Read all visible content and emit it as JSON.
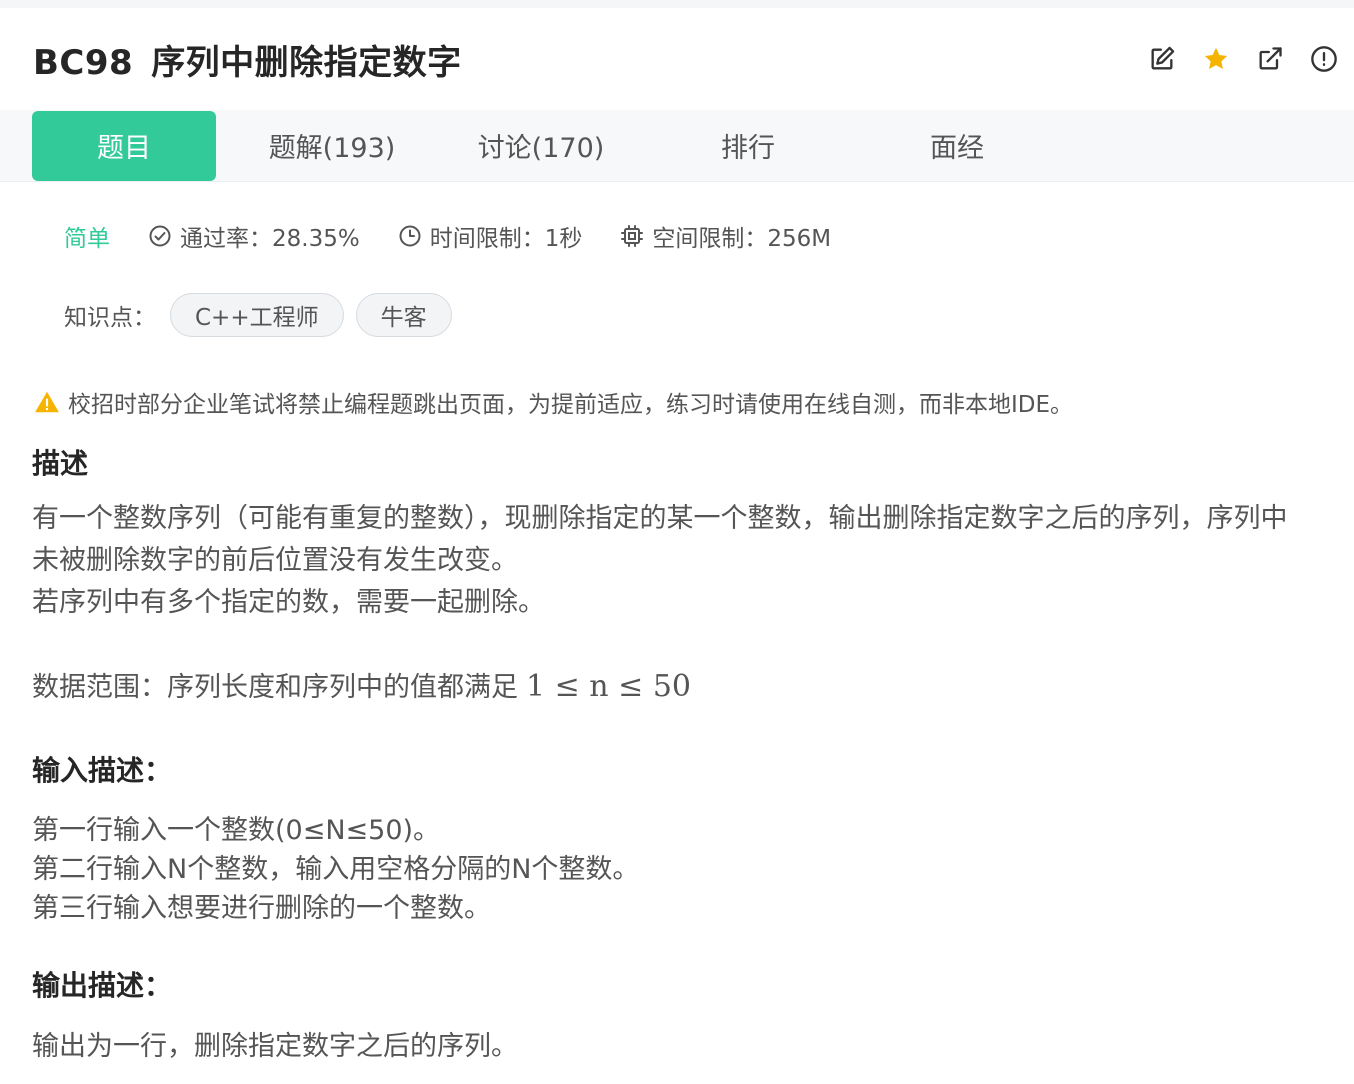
{
  "header": {
    "code": "BC98",
    "title": "序列中删除指定数字",
    "actions": [
      "edit-icon",
      "star-icon",
      "share-icon",
      "report-icon"
    ],
    "star_color": "#f5b400"
  },
  "tabs": [
    {
      "label": "题目",
      "active": true
    },
    {
      "label": "题解(193)",
      "active": false
    },
    {
      "label": "讨论(170)",
      "active": false
    },
    {
      "label": "排行",
      "active": false
    },
    {
      "label": "面经",
      "active": false
    }
  ],
  "accent_color": "#32ca99",
  "meta": {
    "difficulty": "简单",
    "pass_rate": "通过率：28.35%",
    "time_limit": "时间限制：1秒",
    "space_limit": "空间限制：256M"
  },
  "knowledge": {
    "label": "知识点：",
    "tags": [
      "C++工程师",
      "牛客"
    ]
  },
  "notice": "校招时部分企业笔试将禁止编程题跳出页面，为提前适应，练习时请使用在线自测，而非本地IDE。",
  "description": {
    "title": "描述",
    "lines": [
      "有一个整数序列（可能有重复的整数），现删除指定的某一个整数，输出删除指定数字之后的序列，序列中",
      "未被删除数字的前后位置没有发生改变。",
      "若序列中有多个指定的数，需要一起删除。"
    ],
    "range_text": "数据范围：序列长度和序列中的值都满足",
    "range_math": "1 ≤ n ≤ 50"
  },
  "input": {
    "title": "输入描述：",
    "lines": [
      "第一行输入一个整数(0≤N≤50)。",
      "第二行输入N个整数，输入用空格分隔的N个整数。",
      "第三行输入想要进行删除的一个整数。"
    ]
  },
  "output": {
    "title": "输出描述：",
    "lines": [
      "输出为一行，删除指定数字之后的序列。"
    ]
  }
}
